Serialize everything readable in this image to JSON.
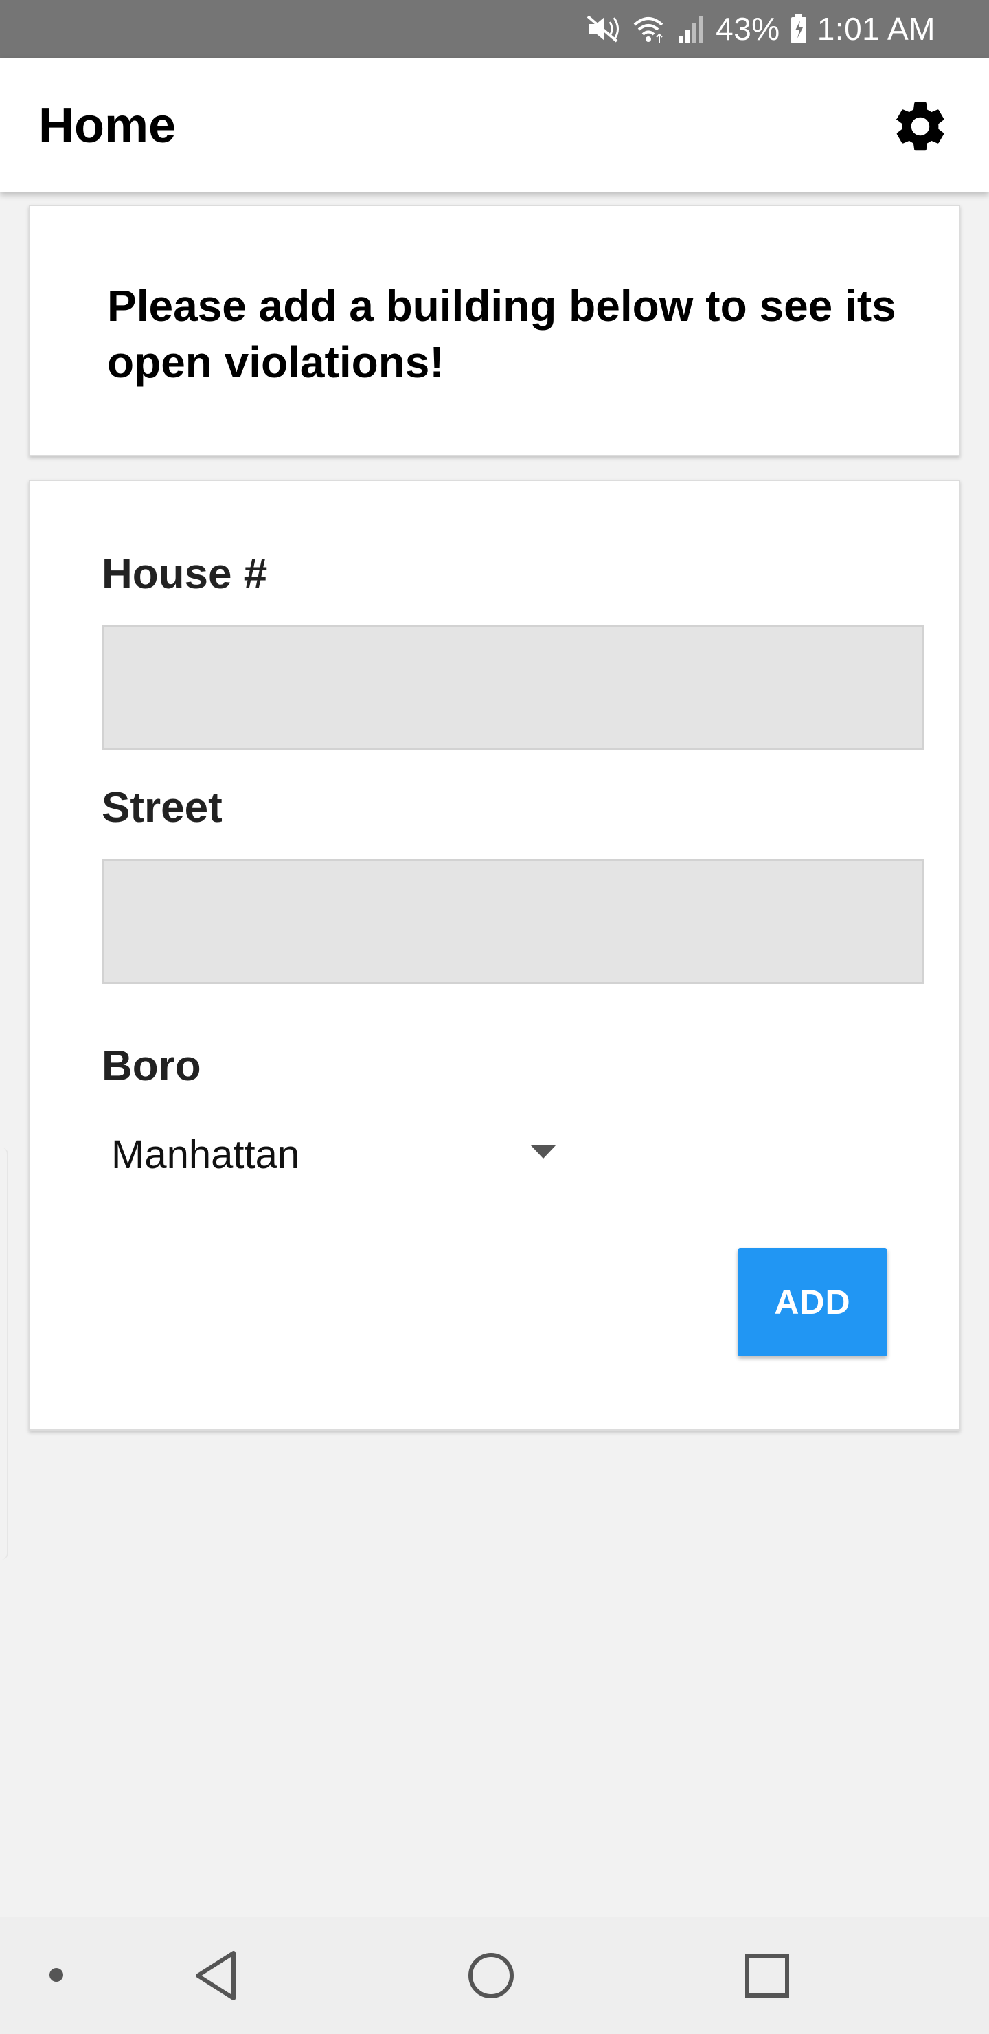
{
  "status_bar": {
    "battery_percent": "43%",
    "time": "1:01 AM",
    "icons": [
      "mute-icon",
      "wifi-icon",
      "signal-icon",
      "battery-charging-icon"
    ]
  },
  "app_bar": {
    "title": "Home",
    "settings_icon": "gear-icon"
  },
  "message_card": {
    "text": "Please add a building below to see its open violations!"
  },
  "form": {
    "house_label": "House #",
    "house_value": "",
    "street_label": "Street",
    "street_value": "",
    "boro_label": "Boro",
    "boro_selected": "Manhattan",
    "add_button": "ADD"
  },
  "nav_bar": {
    "icons": [
      "dot-icon",
      "back-icon",
      "home-icon",
      "recent-apps-icon"
    ]
  },
  "colors": {
    "status_bar": "#757575",
    "accent": "#2196f3",
    "background": "#f2f2f2",
    "input_fill": "#e4e4e4"
  }
}
